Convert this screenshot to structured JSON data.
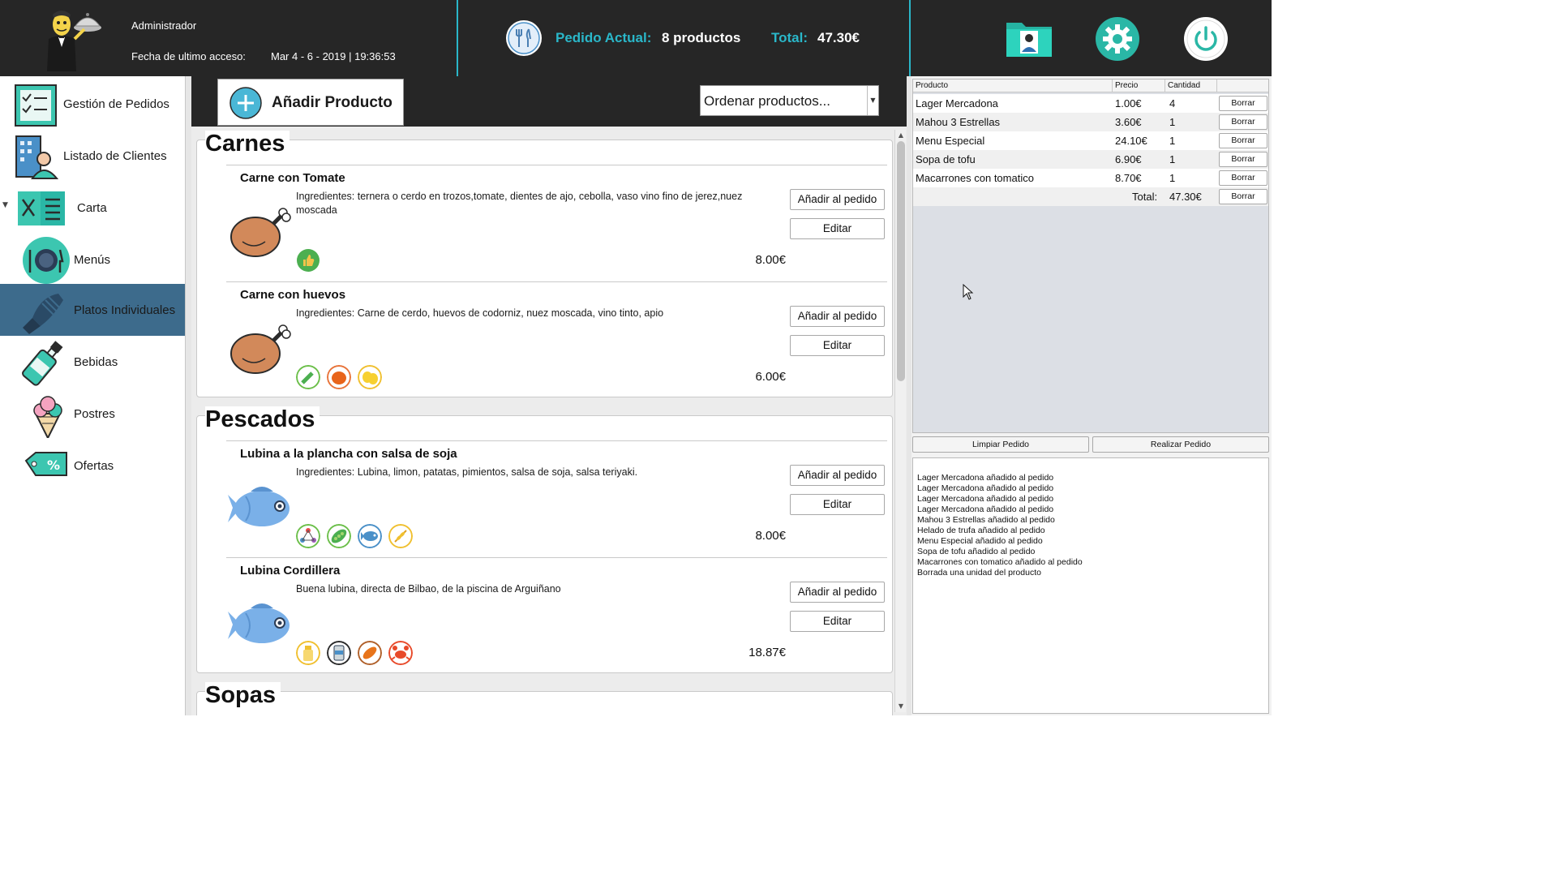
{
  "header": {
    "user_name": "Administrador",
    "last_access_label": "Fecha de ultimo acceso:",
    "last_access_value": "Mar 4 - 6 - 2019 | 19:36:53",
    "order_label": "Pedido Actual:",
    "order_value": "8 productos",
    "total_label": "Total:",
    "total_value": "47.30€",
    "buttons": [
      "profile-folder-icon",
      "settings-gear-icon",
      "power-icon"
    ]
  },
  "sidebar": {
    "items": [
      {
        "label": "Gestión de Pedidos",
        "icon": "checklist-icon"
      },
      {
        "label": "Listado de Clientes",
        "icon": "clients-building-icon"
      },
      {
        "label": "Carta",
        "icon": "menu-card-icon"
      },
      {
        "label": "Menús",
        "icon": "plate-cutlery-icon"
      },
      {
        "label": "Platos Individuales",
        "icon": "dish-icon"
      },
      {
        "label": "Bebidas",
        "icon": "bottle-icon"
      },
      {
        "label": "Postres",
        "icon": "ice-cream-icon"
      },
      {
        "label": "Ofertas",
        "icon": "discount-tag-icon"
      }
    ],
    "active_index": 4
  },
  "toolbar": {
    "add_product_label": "Añadir Producto",
    "sort_value": "Ordenar productos..."
  },
  "product_labels": {
    "add_to_order": "Añadir al pedido",
    "edit": "Editar"
  },
  "sections": [
    {
      "title": "Carnes",
      "products": [
        {
          "name": "Carne con Tomate",
          "description": "Ingredientes: ternera o cerdo en trozos,tomate, dientes de ajo, cebolla, vaso vino fino de jerez,nuez moscada",
          "price": "8.00€",
          "image": "chicken-leg-icon",
          "tags": [
            "thumbs-up-icon"
          ]
        },
        {
          "name": "Carne con huevos",
          "description": "Ingredientes: Carne de cerdo, huevos de codorniz, nuez moscada, vino tinto, apio",
          "price": "6.00€",
          "image": "chicken-leg-icon",
          "tags": [
            "celery-icon",
            "nut-icon",
            "egg-icon"
          ]
        }
      ]
    },
    {
      "title": "Pescados",
      "products": [
        {
          "name": "Lubina a la plancha con salsa de soja",
          "description": "Ingredientes: Lubina, limon, patatas, pimientos, salsa de soja, salsa teriyaki.",
          "price": "8.00€",
          "image": "fish-icon",
          "tags": [
            "molecule-icon",
            "soy-icon",
            "fish-small-icon",
            "wheat-icon"
          ]
        },
        {
          "name": "Lubina Cordillera",
          "description": "Buena lubina, directa de Bilbao, de la piscina de Arguiñano",
          "price": "18.87€",
          "image": "fish-icon",
          "tags": [
            "milk-bottle-icon",
            "can-icon",
            "peanut-icon",
            "crab-icon"
          ]
        }
      ]
    },
    {
      "title": "Sopas",
      "products": []
    }
  ],
  "order_table": {
    "headers": [
      "Producto",
      "Precio",
      "Cantidad",
      ""
    ],
    "rows": [
      {
        "product": "Lager Mercadona",
        "price": "1.00€",
        "qty": "4"
      },
      {
        "product": "Mahou 3 Estrellas",
        "price": "3.60€",
        "qty": "1"
      },
      {
        "product": "Menu Especial",
        "price": "24.10€",
        "qty": "1"
      },
      {
        "product": "Sopa de tofu",
        "price": "6.90€",
        "qty": "1"
      },
      {
        "product": "Macarrones con tomatico",
        "price": "8.70€",
        "qty": "1"
      }
    ],
    "total_label": "Total:",
    "total_value": "47.30€",
    "delete_label": "Borrar"
  },
  "actions": {
    "clear_label": "Limpiar Pedido",
    "submit_label": "Realizar Pedido"
  },
  "log": [
    "Lager Mercadona añadido al pedido",
    "Lager Mercadona añadido al pedido",
    "Lager Mercadona añadido al pedido",
    "Lager Mercadona añadido al pedido",
    "Mahou 3 Estrellas añadido al pedido",
    "Helado de trufa añadido al pedido",
    "Menu Especial añadido al pedido",
    "Sopa de tofu añadido al pedido",
    "Macarrones con tomatico añadido al pedido",
    "Borrada una unidad del producto"
  ],
  "colors": {
    "header_bg": "#262626",
    "accent": "#2ab7c9",
    "active_nav": "#3d6b8c"
  }
}
